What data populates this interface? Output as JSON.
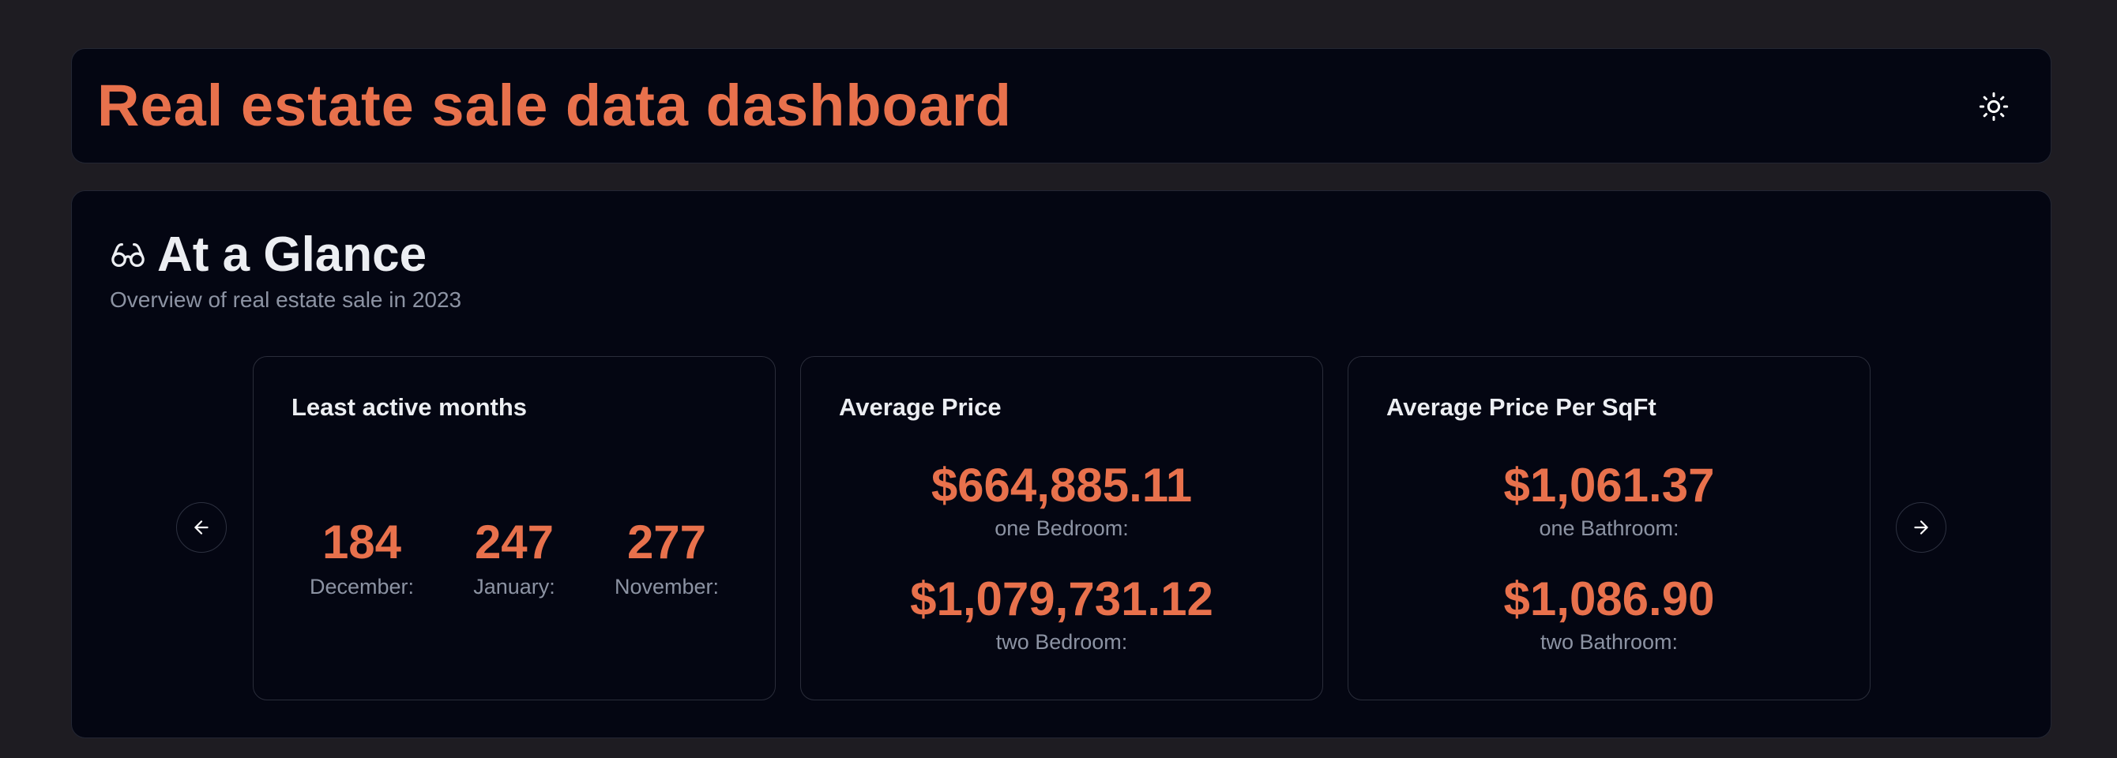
{
  "header": {
    "title": "Real estate sale data dashboard",
    "theme_icon": "sun-icon"
  },
  "glance": {
    "icon": "glasses-icon",
    "title": "At a Glance",
    "subtitle": "Overview of real estate sale in 2023",
    "prev_icon": "arrow-left-icon",
    "next_icon": "arrow-right-icon",
    "cards": {
      "least_active": {
        "title": "Least active months",
        "months": [
          {
            "value": "184",
            "label": "December:"
          },
          {
            "value": "247",
            "label": "January:"
          },
          {
            "value": "277",
            "label": "November:"
          }
        ]
      },
      "average_price": {
        "title": "Average Price",
        "stats": [
          {
            "value": "$664,885.11",
            "label": "one Bedroom:"
          },
          {
            "value": "$1,079,731.12",
            "label": "two Bedroom:"
          }
        ]
      },
      "average_price_sqft": {
        "title": "Average Price Per SqFt",
        "stats": [
          {
            "value": "$1,061.37",
            "label": "one Bathroom:"
          },
          {
            "value": "$1,086.90",
            "label": "two Bathroom:"
          }
        ]
      }
    }
  },
  "colors": {
    "accent": "#e8714c",
    "background": "#1e1c22",
    "panel": "#040612",
    "text": "#eceef2",
    "muted": "#8c93a3"
  }
}
